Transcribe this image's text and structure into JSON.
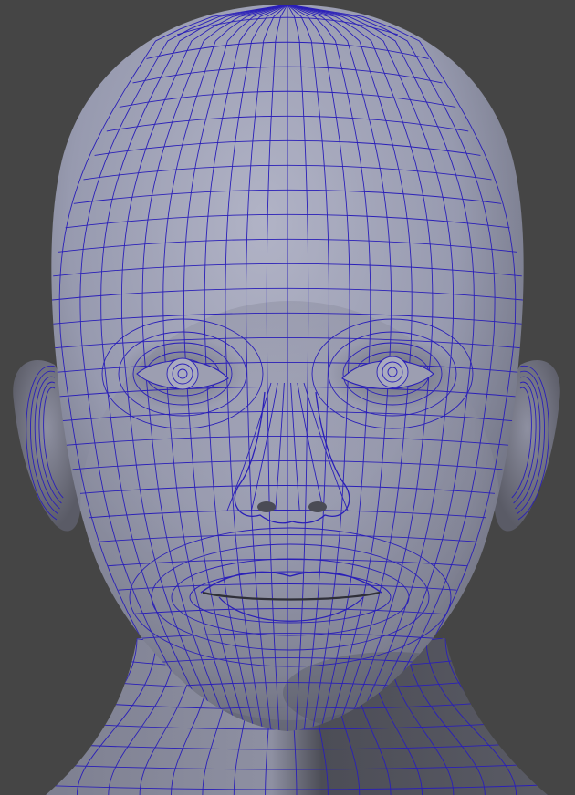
{
  "scene": {
    "subject": "head-wireframe-mesh",
    "colors": {
      "background": "#454545",
      "skin_light": "#a7a9bb",
      "skin_mid": "#8b8c9c",
      "skin_shadow": "#55565f",
      "wireframe": "#2a1fb8"
    },
    "wire_density": {
      "head_meridians": 22,
      "head_parallels": 30
    }
  }
}
